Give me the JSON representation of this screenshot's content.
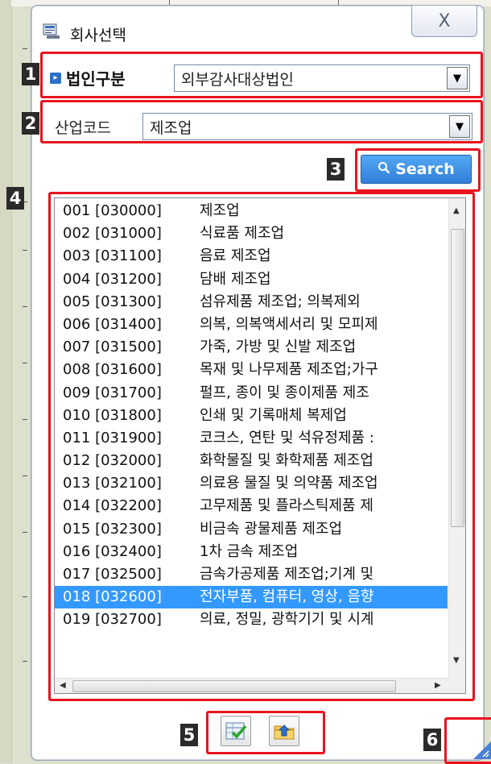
{
  "window": {
    "title": "회사선택",
    "close_label": "X",
    "icons": {
      "app": "window-app-icon",
      "close": "close-icon"
    }
  },
  "section1": {
    "badge": "1",
    "label": "법인구분",
    "value": "외부감사대상법인"
  },
  "section2": {
    "badge": "2",
    "label": "산업코드",
    "value": "제조업"
  },
  "section3": {
    "badge": "3",
    "search_label": "Search",
    "icon": "search-icon"
  },
  "section4": {
    "badge": "4",
    "items": [
      {
        "code": "001 [030000]",
        "name": "제조업"
      },
      {
        "code": "002 [031000]",
        "name": "식료품 제조업"
      },
      {
        "code": "003 [031100]",
        "name": "음료 제조업"
      },
      {
        "code": "004 [031200]",
        "name": "담배 제조업"
      },
      {
        "code": "005 [031300]",
        "name": "섬유제품 제조업; 의복제외"
      },
      {
        "code": "006 [031400]",
        "name": "의복, 의복액세서리 및 모피제"
      },
      {
        "code": "007 [031500]",
        "name": "가죽, 가방 및 신발 제조업"
      },
      {
        "code": "008 [031600]",
        "name": "목재 및 나무제품 제조업;가구"
      },
      {
        "code": "009 [031700]",
        "name": "펄프, 종이 및 종이제품 제조"
      },
      {
        "code": "010 [031800]",
        "name": "인쇄 및 기록매체 복제업"
      },
      {
        "code": "011 [031900]",
        "name": "코크스, 연탄 및 석유정제품 :"
      },
      {
        "code": "012 [032000]",
        "name": "화학물질 및 화학제품 제조업"
      },
      {
        "code": "013 [032100]",
        "name": "의료용 물질 및 의약품 제조업"
      },
      {
        "code": "014 [032200]",
        "name": "고무제품 및 플라스틱제품 제"
      },
      {
        "code": "015 [032300]",
        "name": "비금속 광물제품 제조업"
      },
      {
        "code": "016 [032400]",
        "name": "1차 금속 제조업"
      },
      {
        "code": "017 [032500]",
        "name": "금속가공제품 제조업;기계 및"
      },
      {
        "code": "018 [032600]",
        "name": "전자부품, 컴퓨터, 영상, 음향",
        "selected": true
      },
      {
        "code": "019 [032700]",
        "name": "의료, 정밀, 광학기기 및 시계"
      }
    ]
  },
  "section5": {
    "badge": "5",
    "buttons": [
      "confirm-check-icon",
      "export-folder-icon"
    ]
  },
  "section6": {
    "badge": "6",
    "icon": "resize-grip-icon"
  }
}
